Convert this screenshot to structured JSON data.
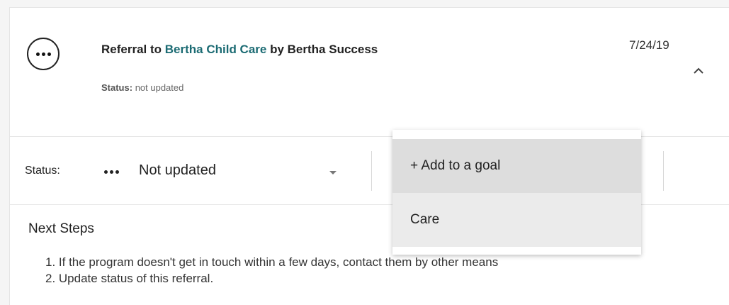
{
  "referral": {
    "title_prefix": "Referral to",
    "organization": "Bertha Child Care",
    "title_suffix": "by Bertha Success",
    "status_label": "Status:",
    "status_value": "not updated",
    "date": "7/24/19"
  },
  "controls": {
    "status_label": "Status:",
    "status_selected": "Not updated"
  },
  "dropdown_menu": {
    "items": [
      {
        "label": "+ Add to a goal",
        "active": true
      },
      {
        "label": "Care",
        "active": false
      }
    ]
  },
  "next_steps": {
    "title": "Next Steps",
    "items": [
      "1. If the program doesn't get in touch within a few days, contact them by other means",
      "2. Update status of this referral."
    ]
  },
  "icons": {
    "more": "more-horizontal-icon",
    "collapse": "chevron-up-icon",
    "status": "more-horizontal-icon",
    "dropdown": "caret-down-icon"
  },
  "colors": {
    "org_link": "#1b6b73",
    "menu_active_bg": "#dddddd",
    "menu_bg": "#ebebeb"
  }
}
